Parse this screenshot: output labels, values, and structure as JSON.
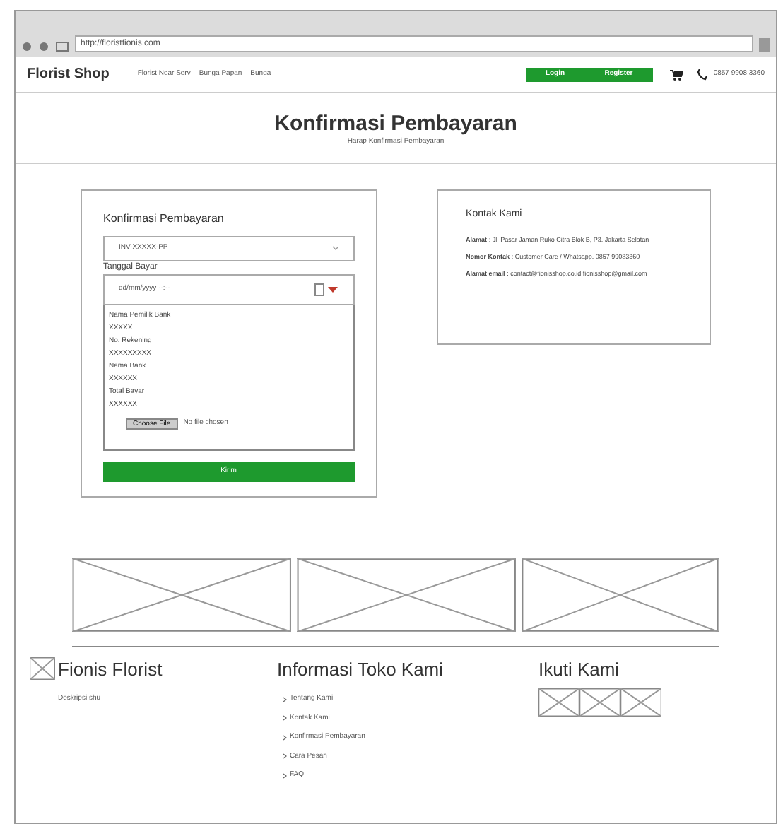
{
  "browser": {
    "url": "http://floristfionis.com"
  },
  "nav": {
    "brand": "Florist Shop",
    "links": [
      "Florist Near Serv",
      "Bunga Papan",
      "Bunga"
    ],
    "buttons": [
      "Login",
      "Register"
    ],
    "phone": "0857 9908 3360"
  },
  "hero": {
    "title": "Konfirmasi Pembayaran",
    "subtitle": "Harap Konfirmasi Pembayaran"
  },
  "form": {
    "title": "Konfirmasi Pembayaran",
    "invoice": "INV-XXXXX-PP",
    "date_label": "Tanggal Bayar",
    "date_placeholder": "dd/mm/yyyy --:--",
    "fields": [
      {
        "label": "Nama Pemilik Bank",
        "value": "XXXXX"
      },
      {
        "label": "No. Rekening",
        "value": "XXXXXXXXX"
      },
      {
        "label": "Nama Bank",
        "value": "XXXXXX"
      },
      {
        "label": "Total Bayar",
        "value": "XXXXXX"
      }
    ],
    "file_button": "Choose File",
    "file_status": "No file chosen",
    "submit": "Kirim"
  },
  "contact": {
    "title": "Kontak Kami",
    "items": [
      {
        "label": "Alamat",
        "text": " : Jl. Pasar Jaman Ruko Citra Blok B, P3. Jakarta Selatan"
      },
      {
        "label": "Nomor Kontak",
        "text": " : Customer Care / Whatsapp. 0857 99083360"
      },
      {
        "label": "Alamat email",
        "text": " : contact@fionisshop.co.id fionisshop@gmail.com"
      }
    ]
  },
  "banners": [
    {
      "kind": "placeholder"
    },
    {
      "kind": "placeholder"
    },
    {
      "kind": "placeholder"
    }
  ],
  "footer": {
    "brand": "Fionis Florist",
    "description": "Deskripsi shu",
    "info_title": "Informasi Toko Kami",
    "links": [
      "Tentang Kami",
      "Kontak Kami",
      "Konfirmasi Pembayaran",
      "Cara Pesan",
      "FAQ"
    ],
    "follow_title": "Ikuti Kami",
    "socials": [
      {
        "kind": "placeholder"
      },
      {
        "kind": "placeholder"
      },
      {
        "kind": "placeholder"
      }
    ]
  }
}
